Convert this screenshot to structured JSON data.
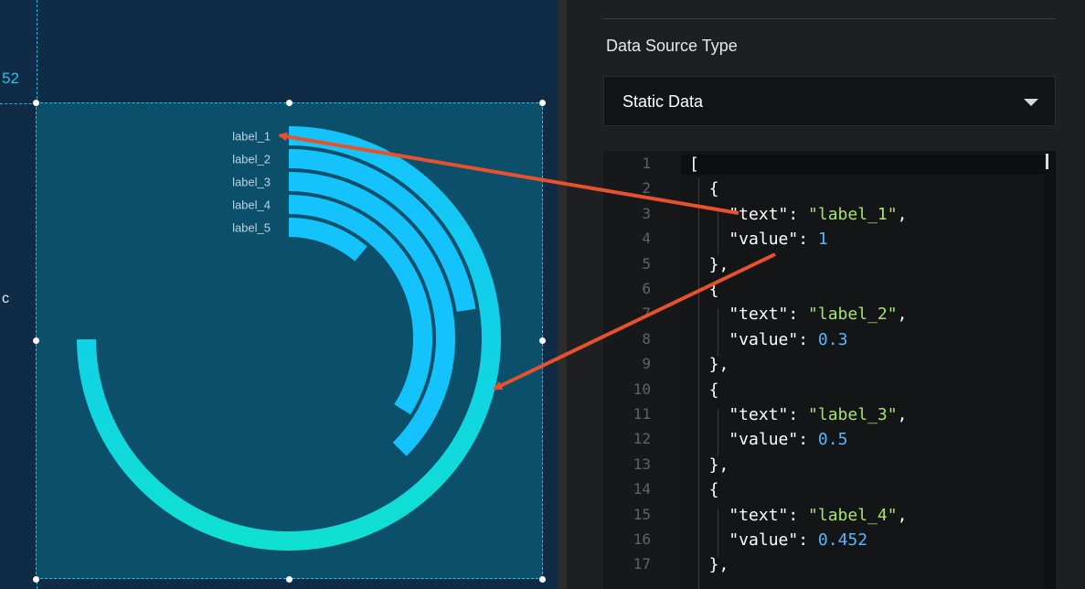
{
  "canvas": {
    "ruler_label": "52",
    "stray_mark": "c"
  },
  "chart_data": {
    "type": "radial-bar",
    "items": [
      {
        "text": "label_1",
        "value": 1
      },
      {
        "text": "label_2",
        "value": 0.3
      },
      {
        "text": "label_3",
        "value": 0.5
      },
      {
        "text": "label_4",
        "value": 0.452
      },
      {
        "text": "label_5",
        "value": 0.15
      }
    ],
    "colors": {
      "bar": "#14c3fb",
      "bar_gradient_end": "#12e0d0",
      "label": "#b9d3de"
    }
  },
  "panel": {
    "data_source_label": "Data Source Type",
    "data_source_value": "Static Data"
  },
  "editor": {
    "line_numbers": [
      "1",
      "2",
      "3",
      "4",
      "5",
      "6",
      "7",
      "8",
      "9",
      "10",
      "11",
      "12",
      "13",
      "14",
      "15",
      "16",
      "17"
    ],
    "lines": [
      [
        {
          "t": "[",
          "c": "k"
        }
      ],
      [
        {
          "t": "  {",
          "c": "k"
        }
      ],
      [
        {
          "t": "    \"text\": ",
          "c": "k"
        },
        {
          "t": "\"label_1\"",
          "c": "s"
        },
        {
          "t": ",",
          "c": "k"
        }
      ],
      [
        {
          "t": "    \"value\": ",
          "c": "k"
        },
        {
          "t": "1",
          "c": "n"
        }
      ],
      [
        {
          "t": "  },",
          "c": "k"
        }
      ],
      [
        {
          "t": "  {",
          "c": "k"
        }
      ],
      [
        {
          "t": "    \"text\": ",
          "c": "k"
        },
        {
          "t": "\"label_2\"",
          "c": "s"
        },
        {
          "t": ",",
          "c": "k"
        }
      ],
      [
        {
          "t": "    \"value\": ",
          "c": "k"
        },
        {
          "t": "0.3",
          "c": "n"
        }
      ],
      [
        {
          "t": "  },",
          "c": "k"
        }
      ],
      [
        {
          "t": "  {",
          "c": "k"
        }
      ],
      [
        {
          "t": "    \"text\": ",
          "c": "k"
        },
        {
          "t": "\"label_3\"",
          "c": "s"
        },
        {
          "t": ",",
          "c": "k"
        }
      ],
      [
        {
          "t": "    \"value\": ",
          "c": "k"
        },
        {
          "t": "0.5",
          "c": "n"
        }
      ],
      [
        {
          "t": "  },",
          "c": "k"
        }
      ],
      [
        {
          "t": "  {",
          "c": "k"
        }
      ],
      [
        {
          "t": "    \"text\": ",
          "c": "k"
        },
        {
          "t": "\"label_4\"",
          "c": "s"
        },
        {
          "t": ",",
          "c": "k"
        }
      ],
      [
        {
          "t": "    \"value\": ",
          "c": "k"
        },
        {
          "t": "0.452",
          "c": "n"
        }
      ],
      [
        {
          "t": "  },",
          "c": "k"
        }
      ]
    ]
  },
  "annotations": {
    "arrow_color": "#e8512e"
  }
}
